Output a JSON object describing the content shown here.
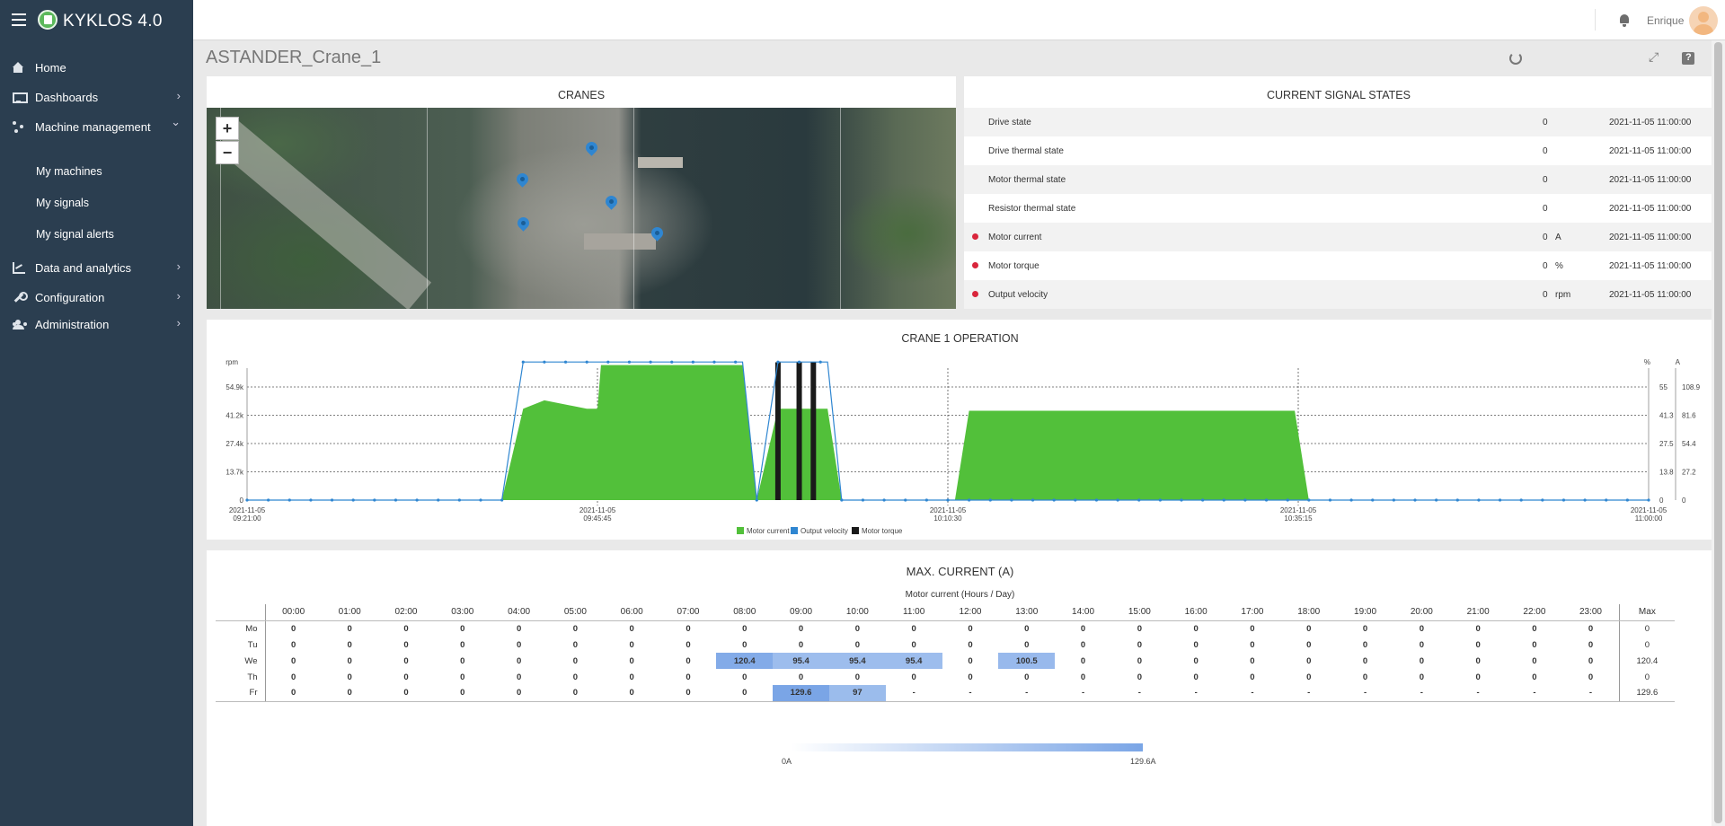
{
  "app": {
    "title": "KYKLOS 4.0",
    "user": "Enrique"
  },
  "sidebar": {
    "items": [
      {
        "label": "Home",
        "icon": "home-icon"
      },
      {
        "label": "Dashboards",
        "icon": "monitor-icon"
      },
      {
        "label": "Machine management",
        "icon": "network-icon"
      },
      {
        "label": "Data and analytics",
        "icon": "chart-icon"
      },
      {
        "label": "Configuration",
        "icon": "wrench-icon"
      },
      {
        "label": "Administration",
        "icon": "users-icon"
      }
    ],
    "subitems": [
      "My machines",
      "My signals",
      "My signal alerts"
    ],
    "chevron_right": "›",
    "chevron_down": "⌄"
  },
  "page": {
    "title": "ASTANDER_Crane_1"
  },
  "cranes": {
    "title": "CRANES",
    "zoom_in": "+",
    "zoom_out": "−"
  },
  "signals": {
    "title": "CURRENT SIGNAL STATES",
    "rows": [
      {
        "name": "Drive state",
        "value": "0",
        "unit": "",
        "time": "2021-11-05 11:00:00",
        "alert": false
      },
      {
        "name": "Drive thermal state",
        "value": "0",
        "unit": "",
        "time": "2021-11-05 11:00:00",
        "alert": false
      },
      {
        "name": "Motor thermal state",
        "value": "0",
        "unit": "",
        "time": "2021-11-05 11:00:00",
        "alert": false
      },
      {
        "name": "Resistor thermal state",
        "value": "0",
        "unit": "",
        "time": "2021-11-05 11:00:00",
        "alert": false
      },
      {
        "name": "Motor current",
        "value": "0",
        "unit": "A",
        "time": "2021-11-05 11:00:00",
        "alert": true
      },
      {
        "name": "Motor torque",
        "value": "0",
        "unit": "%",
        "time": "2021-11-05 11:00:00",
        "alert": true
      },
      {
        "name": "Output velocity",
        "value": "0",
        "unit": "rpm",
        "time": "2021-11-05 11:00:00",
        "alert": true
      }
    ],
    "alert_color": "#d9263c"
  },
  "operation": {
    "title": "CRANE 1 OPERATION",
    "chart_data": {
      "type": "area",
      "x": [
        "09:21:00",
        "09:27:00",
        "09:33:00",
        "09:39:00",
        "09:40:30",
        "09:42:00",
        "09:45:00",
        "09:45:45",
        "09:46:00",
        "09:50:00",
        "09:55:00",
        "09:56:00",
        "09:57:00",
        "09:58:30",
        "09:59:30",
        "10:00:00",
        "10:00:30",
        "10:01:00",
        "10:01:30",
        "10:02:00",
        "10:03:00",
        "10:11:00",
        "10:12:00",
        "10:20:00",
        "10:30:00",
        "10:35:00",
        "10:36:00",
        "11:00:00"
      ],
      "x_ticks": [
        "2021-11-05\n09:21:00",
        "2021-11-05\n09:45:45",
        "2021-11-05\n10:10:30",
        "2021-11-05\n10:35:15",
        "2021-11-05\n11:00:00"
      ],
      "series": [
        {
          "name": "Motor current",
          "color": "#52c03a",
          "axis": "A",
          "values": [
            0,
            0,
            0,
            0,
            88,
            96,
            88,
            88,
            130,
            130,
            130,
            130,
            0,
            88,
            88,
            88,
            88,
            88,
            88,
            88,
            0,
            0,
            86,
            86,
            86,
            86,
            0,
            0
          ]
        },
        {
          "name": "Output velocity",
          "color": "#2f86d1",
          "axis": "rpm",
          "values": [
            0,
            0,
            0,
            0,
            67000,
            67000,
            67000,
            67000,
            67000,
            67000,
            67000,
            67000,
            0,
            67000,
            67000,
            67000,
            67000,
            67000,
            67000,
            67000,
            0,
            0,
            0,
            0,
            0,
            0,
            0,
            0
          ]
        },
        {
          "name": "Motor torque",
          "color": "#1a1a1a",
          "axis": "%",
          "values": [
            0,
            0,
            0,
            0,
            0,
            0,
            0,
            0,
            0,
            0,
            0,
            0,
            0,
            67,
            0,
            67,
            0,
            67,
            0,
            0,
            0,
            0,
            0,
            0,
            0,
            0,
            0,
            0
          ]
        }
      ],
      "y_left": {
        "label": "rpm",
        "ticks": [
          "0",
          "13.7k",
          "27.4k",
          "41.2k",
          "54.9k"
        ]
      },
      "y_right1": {
        "label": "%",
        "ticks": [
          "0",
          "13.8",
          "27.5",
          "41.3",
          "55"
        ]
      },
      "y_right2": {
        "label": "A",
        "ticks": [
          "0",
          "27.2",
          "54.4",
          "81.6",
          "108.9"
        ]
      },
      "legend": [
        "Motor current",
        "Output velocity",
        "Motor torque"
      ],
      "legend_position": "bottom-center",
      "grid": true
    }
  },
  "maxcurrent": {
    "title": "MAX. CURRENT (A)",
    "subtitle": "Motor current (Hours / Day)",
    "hours": [
      "00:00",
      "01:00",
      "02:00",
      "03:00",
      "04:00",
      "05:00",
      "06:00",
      "07:00",
      "08:00",
      "09:00",
      "10:00",
      "11:00",
      "12:00",
      "13:00",
      "14:00",
      "15:00",
      "16:00",
      "17:00",
      "18:00",
      "19:00",
      "20:00",
      "21:00",
      "22:00",
      "23:00"
    ],
    "max_label": "Max",
    "chart_data": {
      "type": "heatmap",
      "rows": [
        {
          "day": "Mo",
          "values": [
            "0",
            "0",
            "0",
            "0",
            "0",
            "0",
            "0",
            "0",
            "0",
            "0",
            "0",
            "0",
            "0",
            "0",
            "0",
            "0",
            "0",
            "0",
            "0",
            "0",
            "0",
            "0",
            "0",
            "0"
          ],
          "max": "0"
        },
        {
          "day": "Tu",
          "values": [
            "0",
            "0",
            "0",
            "0",
            "0",
            "0",
            "0",
            "0",
            "0",
            "0",
            "0",
            "0",
            "0",
            "0",
            "0",
            "0",
            "0",
            "0",
            "0",
            "0",
            "0",
            "0",
            "0",
            "0"
          ],
          "max": "0"
        },
        {
          "day": "We",
          "values": [
            "0",
            "0",
            "0",
            "0",
            "0",
            "0",
            "0",
            "0",
            "120.4",
            "95.4",
            "95.4",
            "95.4",
            "0",
            "100.5",
            "0",
            "0",
            "0",
            "0",
            "0",
            "0",
            "0",
            "0",
            "0",
            "0"
          ],
          "max": "120.4"
        },
        {
          "day": "Th",
          "values": [
            "0",
            "0",
            "0",
            "0",
            "0",
            "0",
            "0",
            "0",
            "0",
            "0",
            "0",
            "0",
            "0",
            "0",
            "0",
            "0",
            "0",
            "0",
            "0",
            "0",
            "0",
            "0",
            "0",
            "0"
          ],
          "max": "0"
        },
        {
          "day": "Fr",
          "values": [
            "0",
            "0",
            "0",
            "0",
            "0",
            "0",
            "0",
            "0",
            "0",
            "129.6",
            "97",
            "-",
            "-",
            "-",
            "-",
            "-",
            "-",
            "-",
            "-",
            "-",
            "-",
            "-",
            "-",
            "-"
          ],
          "max": "129.6"
        }
      ],
      "scale": {
        "min": "0A",
        "max": "129.6A",
        "min_value": 0,
        "max_value": 129.6
      },
      "color_low": "#ffffff",
      "color_high": "#7aa5e6"
    }
  }
}
